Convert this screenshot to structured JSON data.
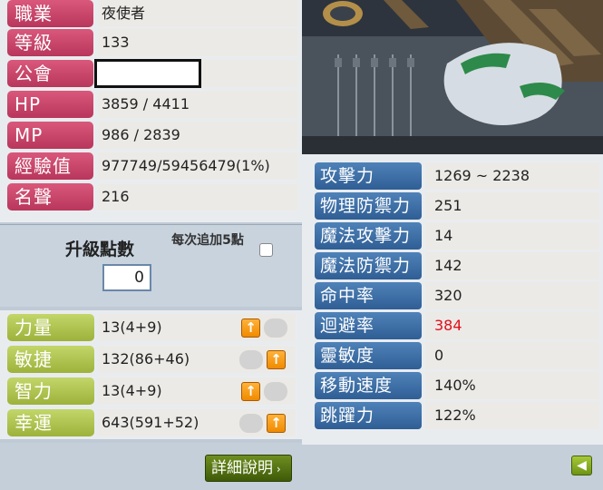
{
  "info": [
    {
      "label": "職業",
      "value": "夜使者"
    },
    {
      "label": "等級",
      "value": "133"
    },
    {
      "label": "公會",
      "value": ""
    },
    {
      "label": "HP",
      "value": "3859 / 4411"
    },
    {
      "label": "MP",
      "value": "986 / 2839"
    },
    {
      "label": "經驗值",
      "value": "977749/59456479(1%)"
    },
    {
      "label": "名聲",
      "value": "216"
    }
  ],
  "ability_points": {
    "title": "升級點數",
    "value": "0",
    "every5_label": "每次追加5點"
  },
  "stats": [
    {
      "label": "力量",
      "value": "13(4+9)"
    },
    {
      "label": "敏捷",
      "value": "132(86+46)"
    },
    {
      "label": "智力",
      "value": "13(4+9)"
    },
    {
      "label": "幸運",
      "value": "643(591+52)"
    }
  ],
  "detail_button": "詳細說明",
  "detail_stats": [
    {
      "label": "攻擊力",
      "value": "1269 ~ 2238"
    },
    {
      "label": "物理防禦力",
      "value": "251"
    },
    {
      "label": "魔法攻擊力",
      "value": "14"
    },
    {
      "label": "魔法防禦力",
      "value": "142"
    },
    {
      "label": "命中率",
      "value": "320"
    },
    {
      "label": "迴避率",
      "value": "384"
    },
    {
      "label": "靈敏度",
      "value": "0"
    },
    {
      "label": "移動速度",
      "value": "140%"
    },
    {
      "label": "跳躍力",
      "value": "122%"
    }
  ],
  "colors": {
    "info_label": "#c84468",
    "stat_label": "#aec24c",
    "detail_label": "#3f70a8",
    "highlight_value": "#e0101a"
  }
}
